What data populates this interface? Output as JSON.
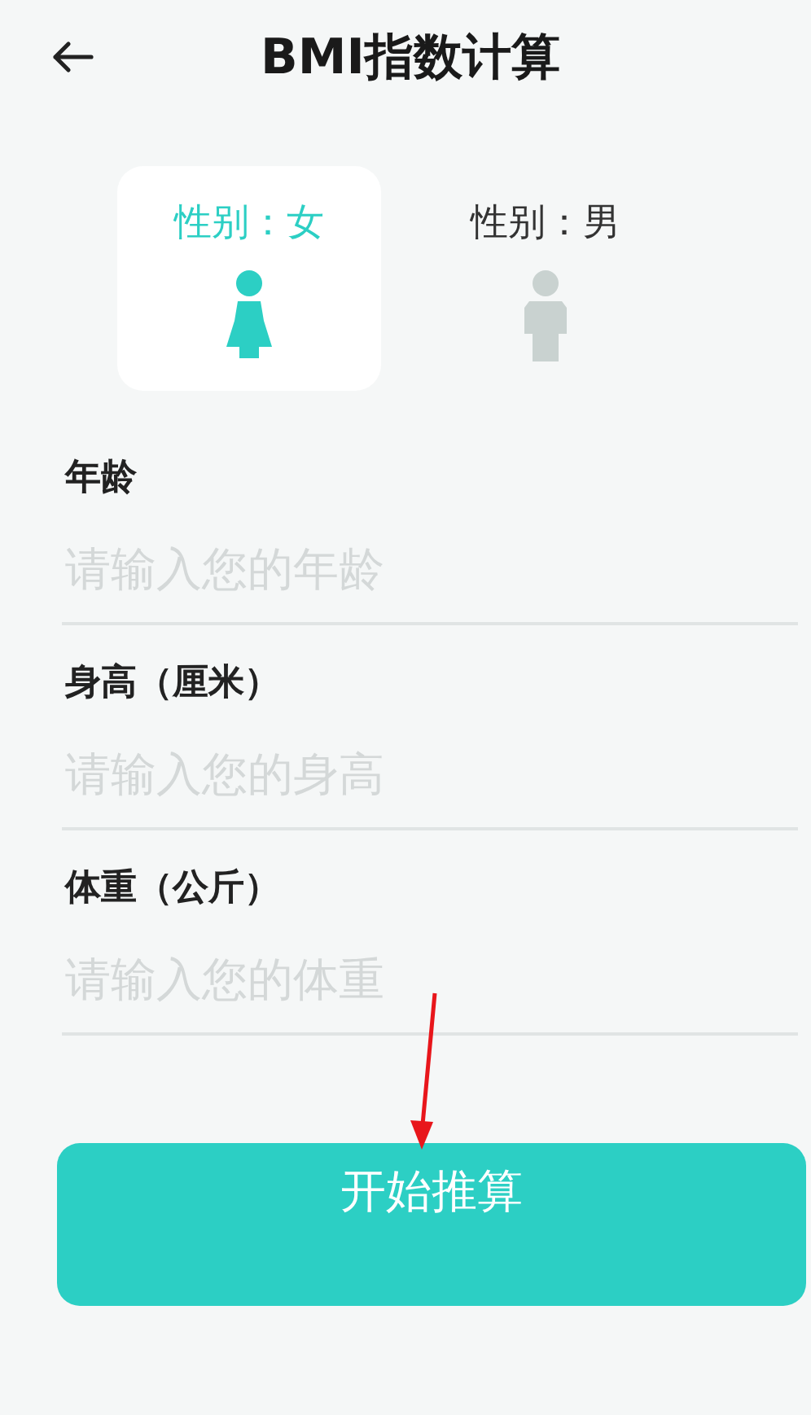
{
  "header": {
    "title": "BMI指数计算"
  },
  "genders": [
    {
      "kind": "female",
      "label": "性别：女",
      "selected": true
    },
    {
      "kind": "male",
      "label": "性别：男",
      "selected": false
    }
  ],
  "fields": [
    {
      "label": "年龄",
      "placeholder": "请输入您的年龄"
    },
    {
      "label": "身高（厘米）",
      "placeholder": "请输入您的身高"
    },
    {
      "label": "体重（公斤）",
      "placeholder": "请输入您的体重"
    }
  ],
  "button": {
    "label": "开始推算"
  }
}
